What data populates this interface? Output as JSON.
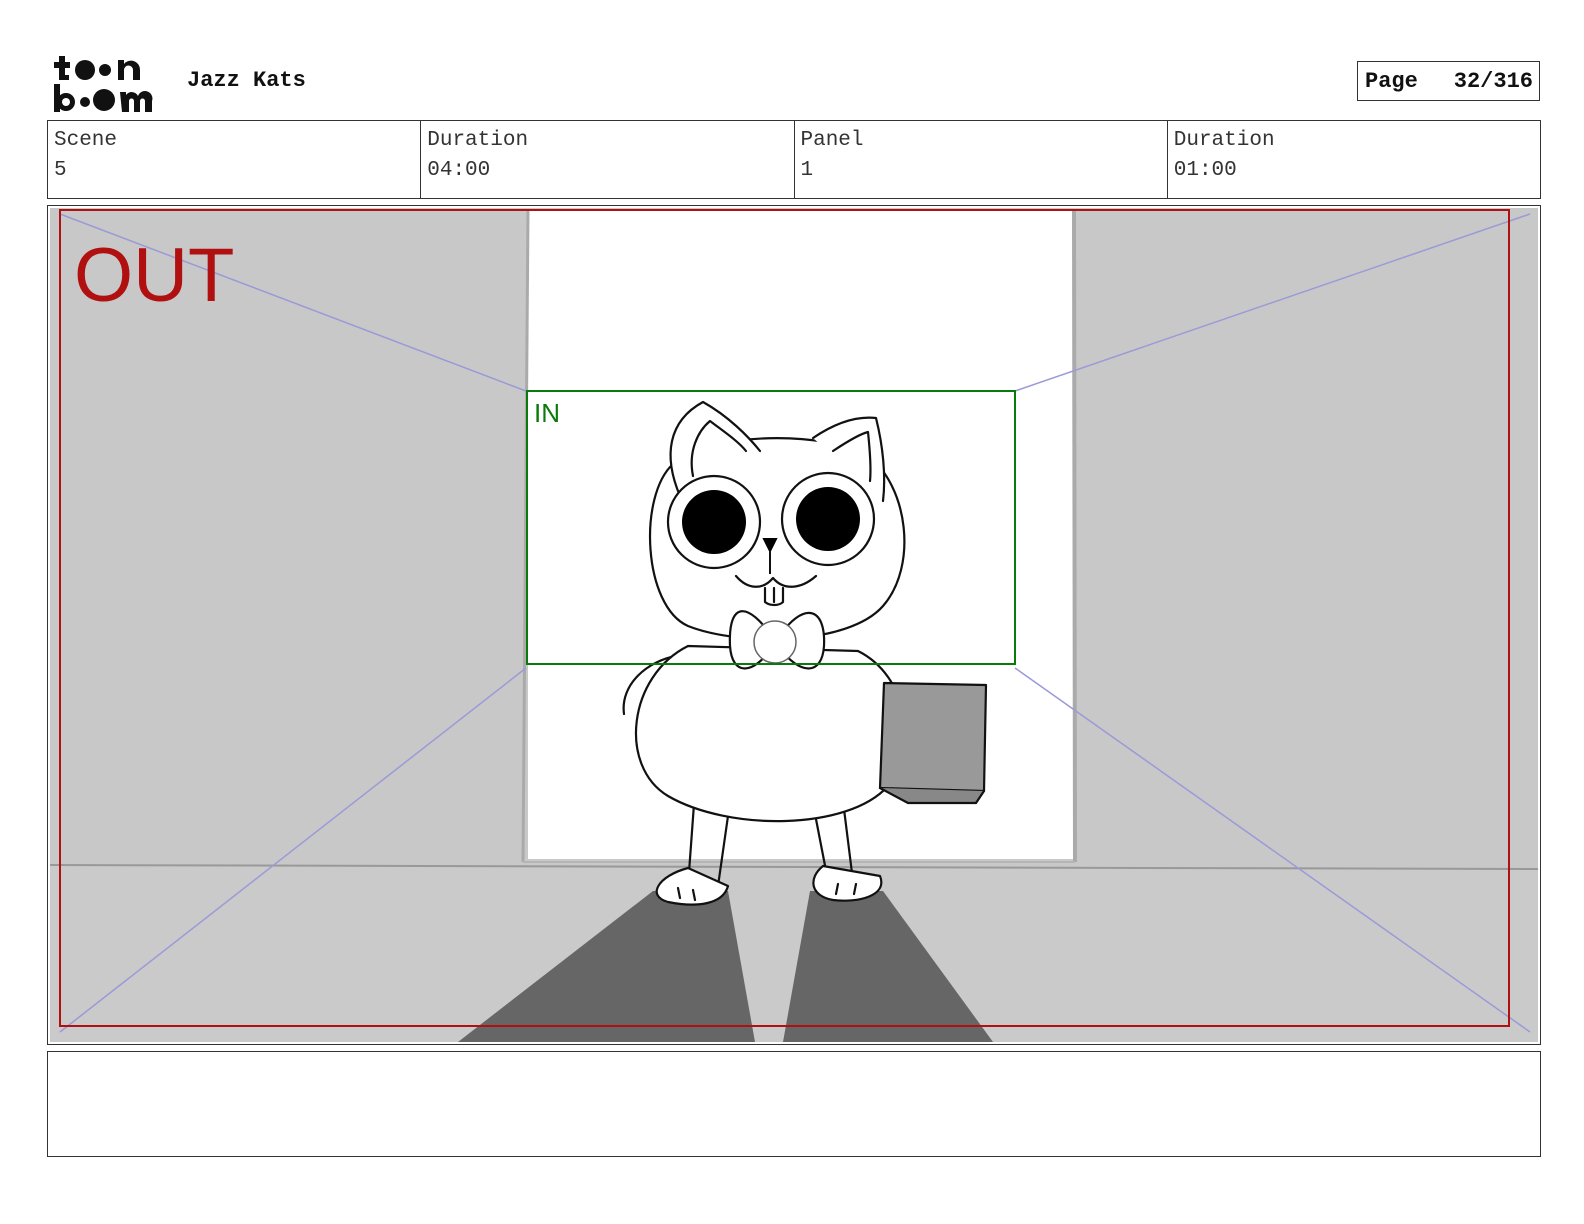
{
  "header": {
    "logo_text": "toon boom",
    "project_title": "Jazz Kats",
    "page_label": "Page",
    "page_value": "32/316"
  },
  "info": {
    "scene_label": "Scene",
    "scene_value": "5",
    "scene_duration_label": "Duration",
    "scene_duration_value": "04:00",
    "panel_label": "Panel",
    "panel_value": "1",
    "panel_duration_label": "Duration",
    "panel_duration_value": "01:00"
  },
  "panel": {
    "out_label": "OUT",
    "in_label": "IN",
    "colors": {
      "out_frame": "#b01010",
      "in_frame": "#0a7a0a",
      "guide_lines": "#9a9ad8",
      "wall_gray": "#c8c8c8",
      "shadow_gray": "#666666"
    }
  },
  "notes": {
    "text": ""
  }
}
